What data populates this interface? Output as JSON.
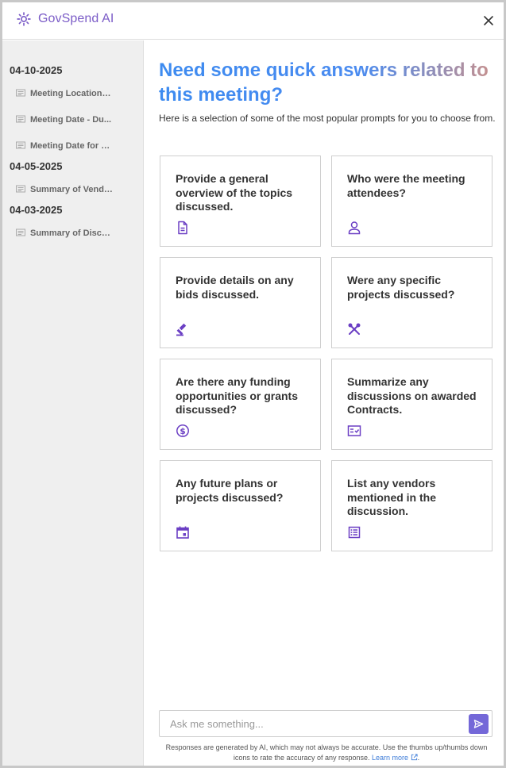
{
  "app": {
    "title": "GovSpend AI"
  },
  "sidebar": {
    "groups": [
      {
        "date": "04-10-2025",
        "items": [
          "Meeting Location f...",
          "Meeting Date - Du...",
          "Meeting Date for B..."
        ]
      },
      {
        "date": "04-05-2025",
        "items": [
          "Summary of Vendo..."
        ]
      },
      {
        "date": "04-03-2025",
        "items": [
          "Summary of Discus..."
        ]
      }
    ]
  },
  "main": {
    "title": "Need some quick answers related to this meeting?",
    "subtitle": "Here is a selection of some of the most popular prompts for you to choose from.",
    "prompts": [
      {
        "label": "Provide a general overview of the topics discussed.",
        "icon": "document-icon"
      },
      {
        "label": "Who were the meeting attendees?",
        "icon": "person-icon"
      },
      {
        "label": "Provide details on any bids discussed.",
        "icon": "gavel-icon"
      },
      {
        "label": "Were any specific projects discussed?",
        "icon": "tools-icon"
      },
      {
        "label": "Are there any funding opportunities or grants discussed?",
        "icon": "dollar-icon"
      },
      {
        "label": "Summarize any discussions on awarded Contracts.",
        "icon": "contract-icon"
      },
      {
        "label": "Any future plans or projects discussed?",
        "icon": "calendar-icon"
      },
      {
        "label": "List any vendors mentioned in the discussion.",
        "icon": "list-icon"
      }
    ]
  },
  "chat": {
    "placeholder": "Ask me something...",
    "disclaimer": "Responses are generated by AI, which may not always be accurate. Use the thumbs up/thumbs down icons to rate the accuracy of any response.",
    "learn_more": "Learn more",
    "learn_more_suffix": "."
  },
  "colors": {
    "accent": "#7b5cc7",
    "title_blue": "#3d8bf0",
    "send_button": "#7468d8",
    "sidebar_bg": "#efefef"
  }
}
